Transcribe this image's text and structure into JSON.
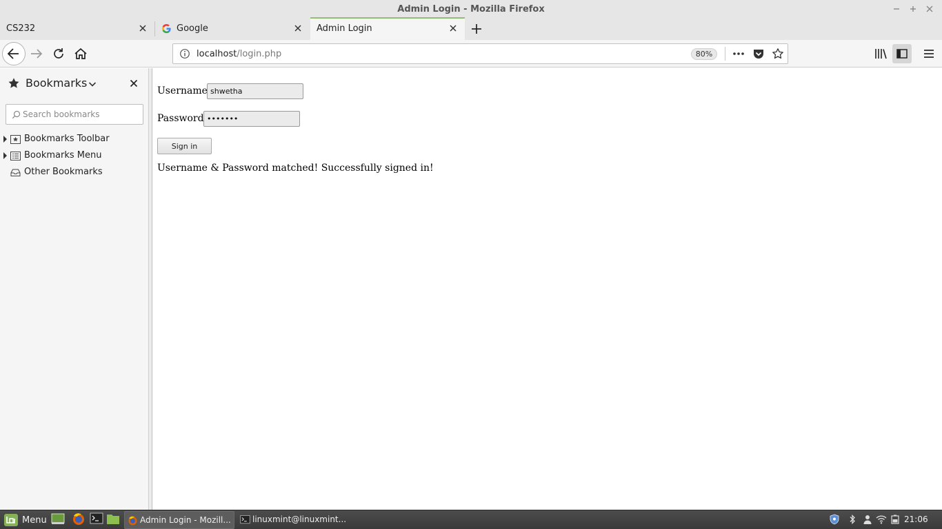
{
  "window": {
    "title": "Admin Login - Mozilla Firefox"
  },
  "tabs": [
    {
      "label": "CS232",
      "selected": false
    },
    {
      "label": "Google",
      "selected": false,
      "icon": "google-g-icon"
    },
    {
      "label": "Admin Login",
      "selected": true
    }
  ],
  "navbar": {
    "url_host": "localhost",
    "url_path": "/login.php",
    "zoom": "80%"
  },
  "sidebar": {
    "title": "Bookmarks",
    "search_placeholder": "Search bookmarks",
    "items": [
      {
        "label": "Bookmarks Toolbar",
        "expandable": true,
        "icon": "bookmarks-toolbar-icon"
      },
      {
        "label": "Bookmarks Menu",
        "expandable": true,
        "icon": "bookmarks-menu-icon"
      },
      {
        "label": "Other Bookmarks",
        "expandable": false,
        "icon": "other-bookmarks-icon"
      }
    ]
  },
  "page": {
    "username_label": "Username",
    "username_value": "shwetha",
    "password_label": "Password",
    "password_value": "shwetha",
    "signin_label": "Sign in",
    "message": "Username & Password matched! Successfully signed in!"
  },
  "taskbar": {
    "menu_label": "Menu",
    "windows": [
      {
        "label": "Admin Login - Mozill...",
        "active": true
      },
      {
        "label": "linuxmint@linuxmint...",
        "active": false
      }
    ],
    "clock": "21:06"
  },
  "colors": {
    "selected_tab_accent": "#8fbf6f",
    "taskbar_bg": "#3f3f3f",
    "mint_green": "#87b158"
  }
}
